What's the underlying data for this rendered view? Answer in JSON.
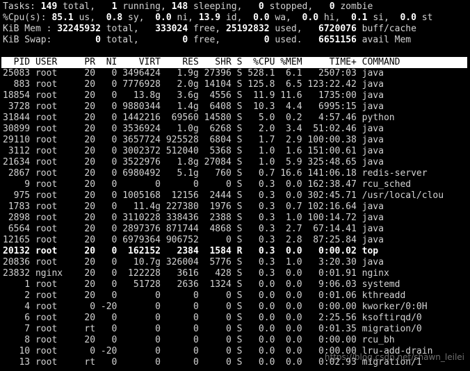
{
  "summary": {
    "tasks": {
      "label": "Tasks:",
      "total_val": "149",
      "total_lbl": "total,",
      "running_val": "1",
      "running_lbl": "running,",
      "sleeping_val": "148",
      "sleeping_lbl": "sleeping,",
      "stopped_val": "0",
      "stopped_lbl": "stopped,",
      "zombie_val": "0",
      "zombie_lbl": "zombie"
    },
    "cpu": {
      "label": "%Cpu(s):",
      "us_val": "85.1",
      "us_lbl": "us,",
      "sy_val": "0.8",
      "sy_lbl": "sy,",
      "ni_val": "0.0",
      "ni_lbl": "ni,",
      "id_val": "13.9",
      "id_lbl": "id,",
      "wa_val": "0.0",
      "wa_lbl": "wa,",
      "hi_val": "0.0",
      "hi_lbl": "hi,",
      "si_val": "0.1",
      "si_lbl": "si,",
      "st_val": "0.0",
      "st_lbl": "st"
    },
    "mem": {
      "label": "KiB Mem :",
      "total_val": "32245932",
      "total_lbl": "total,",
      "free_val": "333024",
      "free_lbl": "free,",
      "used_val": "25192832",
      "used_lbl": "used,",
      "buff_val": "6720076",
      "buff_lbl": "buff/cache"
    },
    "swap": {
      "label": "KiB Swap:",
      "total_val": "0",
      "total_lbl": "total,",
      "free_val": "0",
      "free_lbl": "free,",
      "used_val": "0",
      "used_lbl": "used.",
      "avail_val": "6651156",
      "avail_lbl": "avail Mem"
    }
  },
  "columns": [
    "PID",
    "USER",
    "PR",
    "NI",
    "VIRT",
    "RES",
    "SHR",
    "S",
    "%CPU",
    "%MEM",
    "TIME+",
    "COMMAND"
  ],
  "processes": [
    [
      "25083",
      "root",
      "20",
      "0",
      "3496424",
      "1.9g",
      "27396",
      "S",
      "528.1",
      "6.1",
      "2507:03",
      "java"
    ],
    [
      "883",
      "root",
      "20",
      "0",
      "7776928",
      "2.0g",
      "14104",
      "S",
      "125.8",
      "6.5",
      "123:22.42",
      "java"
    ],
    [
      "18854",
      "root",
      "20",
      "0",
      "13.8g",
      "3.6g",
      "4556",
      "S",
      "11.9",
      "11.6",
      "1735:00",
      "java"
    ],
    [
      "3728",
      "root",
      "20",
      "0",
      "9880344",
      "1.4g",
      "6408",
      "S",
      "10.3",
      "4.4",
      "6995:15",
      "java"
    ],
    [
      "31844",
      "root",
      "20",
      "0",
      "1442216",
      "69560",
      "14580",
      "S",
      "5.0",
      "0.2",
      "4:57.46",
      "python"
    ],
    [
      "30899",
      "root",
      "20",
      "0",
      "3536924",
      "1.0g",
      "6268",
      "S",
      "2.0",
      "3.4",
      "51:02.46",
      "java"
    ],
    [
      "29110",
      "root",
      "20",
      "0",
      "3657724",
      "925528",
      "6804",
      "S",
      "1.7",
      "2.9",
      "100:00.38",
      "java"
    ],
    [
      "3112",
      "root",
      "20",
      "0",
      "3002372",
      "512040",
      "5368",
      "S",
      "1.0",
      "1.6",
      "151:00.61",
      "java"
    ],
    [
      "21634",
      "root",
      "20",
      "0",
      "3522976",
      "1.8g",
      "27084",
      "S",
      "1.0",
      "5.9",
      "325:48.65",
      "java"
    ],
    [
      "2867",
      "root",
      "20",
      "0",
      "6980492",
      "5.1g",
      "760",
      "S",
      "0.7",
      "16.6",
      "141:06.18",
      "redis-server"
    ],
    [
      "9",
      "root",
      "20",
      "0",
      "0",
      "0",
      "0",
      "S",
      "0.3",
      "0.0",
      "162:38.47",
      "rcu_sched"
    ],
    [
      "975",
      "root",
      "20",
      "0",
      "1005168",
      "12156",
      "2444",
      "S",
      "0.3",
      "0.0",
      "302:45.71",
      "/usr/local/clou"
    ],
    [
      "1783",
      "root",
      "20",
      "0",
      "11.4g",
      "227380",
      "1976",
      "S",
      "0.3",
      "0.7",
      "102:16.64",
      "java"
    ],
    [
      "2898",
      "root",
      "20",
      "0",
      "3110228",
      "338436",
      "2388",
      "S",
      "0.3",
      "1.0",
      "100:14.72",
      "java"
    ],
    [
      "6564",
      "root",
      "20",
      "0",
      "2897376",
      "871744",
      "4868",
      "S",
      "0.3",
      "2.7",
      "67:14.41",
      "java"
    ],
    [
      "12165",
      "root",
      "20",
      "0",
      "6979364",
      "906752",
      "0",
      "S",
      "0.3",
      "2.8",
      "87:25.84",
      "java"
    ],
    [
      "20132",
      "root",
      "20",
      "0",
      "162152",
      "2384",
      "1584",
      "R",
      "0.3",
      "0.0",
      "0:00.02",
      "top"
    ],
    [
      "20836",
      "root",
      "20",
      "0",
      "10.7g",
      "326004",
      "5776",
      "S",
      "0.3",
      "1.0",
      "3:20.30",
      "java"
    ],
    [
      "23832",
      "nginx",
      "20",
      "0",
      "122228",
      "3616",
      "428",
      "S",
      "0.3",
      "0.0",
      "0:01.91",
      "nginx"
    ],
    [
      "1",
      "root",
      "20",
      "0",
      "51728",
      "2636",
      "1324",
      "S",
      "0.0",
      "0.0",
      "9:06.03",
      "systemd"
    ],
    [
      "2",
      "root",
      "20",
      "0",
      "0",
      "0",
      "0",
      "S",
      "0.0",
      "0.0",
      "0:01.06",
      "kthreadd"
    ],
    [
      "4",
      "root",
      "0",
      "-20",
      "0",
      "0",
      "0",
      "S",
      "0.0",
      "0.0",
      "0:00.00",
      "kworker/0:0H"
    ],
    [
      "6",
      "root",
      "20",
      "0",
      "0",
      "0",
      "0",
      "S",
      "0.0",
      "0.0",
      "2:25.56",
      "ksoftirqd/0"
    ],
    [
      "7",
      "root",
      "rt",
      "0",
      "0",
      "0",
      "0",
      "S",
      "0.0",
      "0.0",
      "0:01.35",
      "migration/0"
    ],
    [
      "8",
      "root",
      "20",
      "0",
      "0",
      "0",
      "0",
      "S",
      "0.0",
      "0.0",
      "0:00.00",
      "rcu_bh"
    ],
    [
      "10",
      "root",
      "0",
      "-20",
      "0",
      "0",
      "0",
      "S",
      "0.0",
      "0.0",
      "0:00.00",
      "lru-add-drain"
    ],
    [
      "13",
      "root",
      "rt",
      "0",
      "0",
      "0",
      "0",
      "S",
      "0.0",
      "0.0",
      "0:02.93",
      "migration/1"
    ]
  ],
  "highlighted_pid": "20132",
  "watermark": "https://blog.csdn.net/shawn_leilei",
  "colors": {
    "background": "#000000",
    "text": "#d3d3d3",
    "bold_text": "#ffffff",
    "header_bg": "#ffffff",
    "header_fg": "#000000"
  }
}
